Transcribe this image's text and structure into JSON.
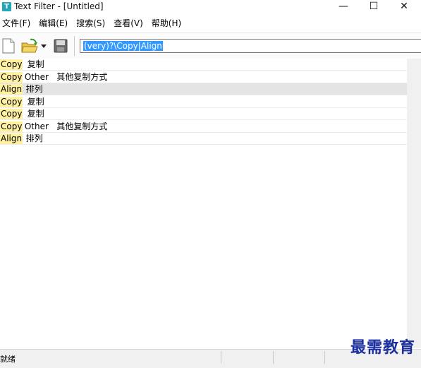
{
  "window": {
    "title": "Text Filter - [Untitled]",
    "icon_glyph": "T",
    "controls": {
      "minimize": "—",
      "maximize": "☐",
      "close": "✕"
    }
  },
  "menu": [
    "文件(F)",
    "编辑(E)",
    "搜索(S)",
    "查看(V)",
    "帮助(H)"
  ],
  "toolbar": {
    "icons": [
      "new-file-icon",
      "open-folder-icon",
      "dropdown-arrow-icon",
      "save-icon"
    ],
    "filter_value": "(very)?\\Copy|Align"
  },
  "rows": [
    {
      "match": "Copy",
      "rest": "  复制",
      "selected": false
    },
    {
      "match": "Copy",
      "rest": " Other   其他复制方式",
      "selected": false
    },
    {
      "match": "Align",
      "rest": "  排列",
      "selected": true
    },
    {
      "match": "Copy",
      "rest": "  复制",
      "selected": false
    },
    {
      "match": "Copy",
      "rest": "  复制",
      "selected": false
    },
    {
      "match": "Copy",
      "rest": " Other   其他复制方式",
      "selected": false
    },
    {
      "match": "Align",
      "rest": "  排列",
      "selected": false
    }
  ],
  "status": {
    "text": "就绪"
  },
  "watermark": "最需教育",
  "colors": {
    "match_highlight": "#fff1a0",
    "selection": "#3399ff",
    "selected_row": "#e4e4e4"
  }
}
